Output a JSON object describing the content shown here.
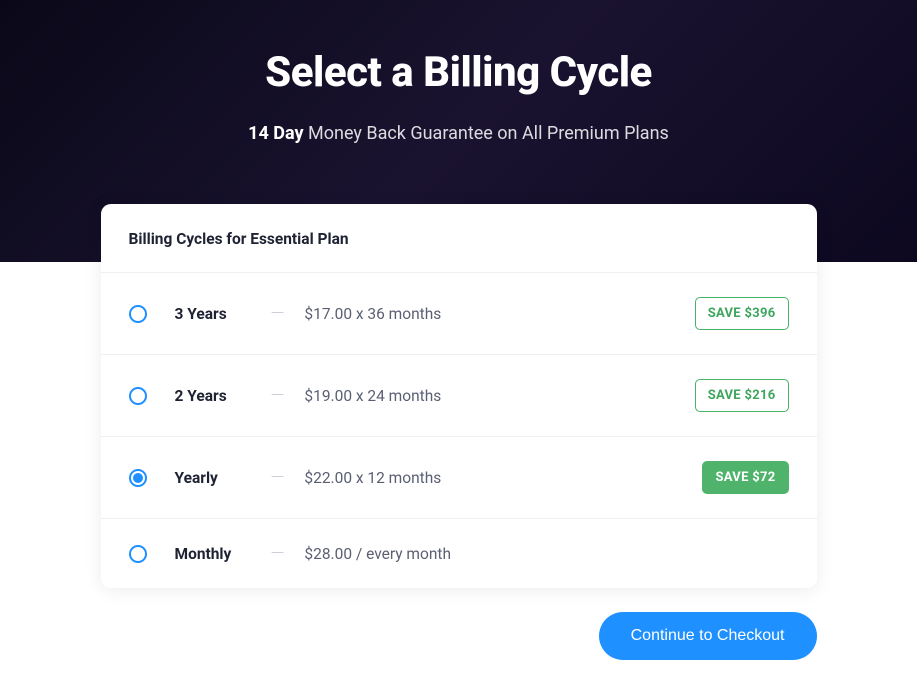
{
  "header": {
    "title": "Select a Billing Cycle",
    "subtitle_bold": "14 Day",
    "subtitle_rest": " Money Back Guarantee on All Premium Plans"
  },
  "card": {
    "title": "Billing Cycles for Essential Plan",
    "rows": [
      {
        "label": "3 Years",
        "price": "$17.00 x 36 months",
        "save": "SAVE $396",
        "selected": false
      },
      {
        "label": "2 Years",
        "price": "$19.00 x 24 months",
        "save": "SAVE $216",
        "selected": false
      },
      {
        "label": "Yearly",
        "price": "$22.00 x 12 months",
        "save": "SAVE $72",
        "selected": true
      },
      {
        "label": "Monthly",
        "price": "$28.00 / every month",
        "save": null,
        "selected": false
      }
    ]
  },
  "checkout_button": "Continue to Checkout"
}
